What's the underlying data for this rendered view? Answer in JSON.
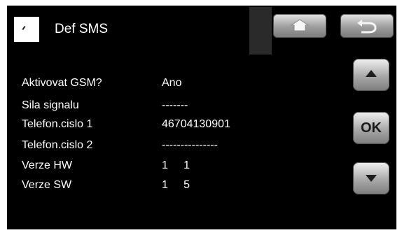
{
  "header": {
    "title": "Def SMS"
  },
  "nav": {
    "home_icon": "home-icon",
    "back_icon": "back-arrow-icon"
  },
  "side": {
    "ok_label": "OK",
    "up_icon": "up-arrow-icon",
    "down_icon": "down-arrow-icon"
  },
  "settings": [
    {
      "label": "Aktivovat GSM?",
      "value": "Ano"
    },
    {
      "label": "Sila signalu",
      "value": "-------"
    },
    {
      "label": "Telefon.cislo 1",
      "value": "46704130901"
    },
    {
      "label": "Telefon.cislo 2",
      "value": "---------------"
    },
    {
      "label": "Verze HW",
      "value": "1     1"
    },
    {
      "label": "Verze SW",
      "value": "1     5"
    }
  ]
}
